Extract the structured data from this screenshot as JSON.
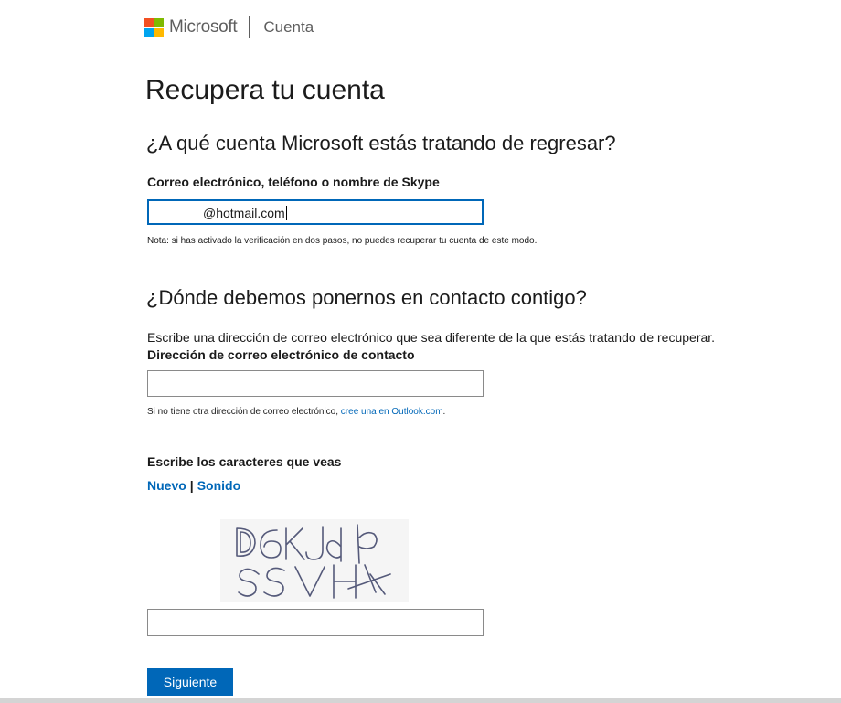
{
  "header": {
    "brand": "Microsoft",
    "section": "Cuenta",
    "logo_colors": [
      "#f25022",
      "#7fba00",
      "#00a4ef",
      "#ffb900"
    ]
  },
  "title": "Recupera tu cuenta",
  "account_section": {
    "heading": "¿A qué cuenta Microsoft estás tratando de regresar?",
    "field_label": "Correo electrónico, teléfono o nombre de Skype",
    "field_value": "@hotmail.com",
    "note": "Nota: si has activado la verificación en dos pasos, no puedes recuperar tu cuenta de este modo."
  },
  "contact_section": {
    "heading": "¿Dónde debemos ponernos en contacto contigo?",
    "description": "Escribe una dirección de correo electrónico que sea diferente de la que estás tratando de recuperar.",
    "field_label": "Dirección de correo electrónico de contacto",
    "field_value": "",
    "note_prefix": "Si no tiene otra dirección de correo electrónico, ",
    "note_link": "cree una en Outlook.com",
    "note_suffix": "."
  },
  "captcha_section": {
    "label": "Escribe los caracteres que veas",
    "new_link": "Nuevo",
    "separator": "|",
    "audio_link": "Sonido",
    "image_text": "D6KJd SSVH",
    "field_value": ""
  },
  "next_button": "Siguiente",
  "colors": {
    "accent": "#0067b8"
  }
}
